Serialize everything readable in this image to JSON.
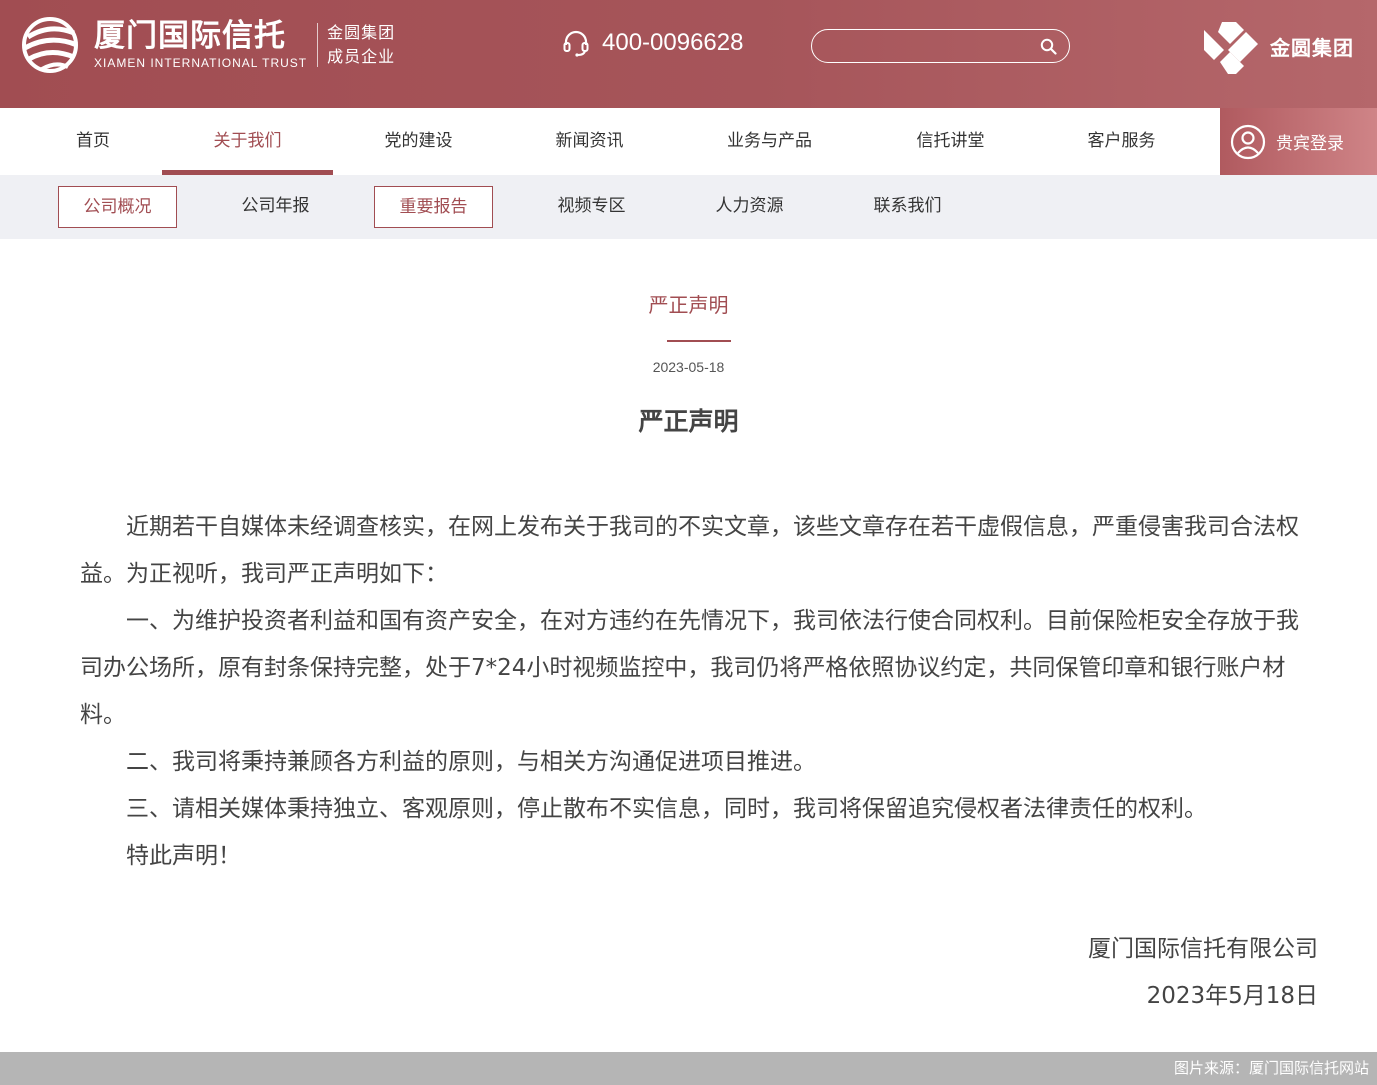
{
  "header": {
    "logo_cn": "厦门国际信托",
    "logo_en": "XIAMEN INTERNATIONAL TRUST",
    "group_line1": "金圆集团",
    "group_line2": "成员企业",
    "hotline": "400-0096628",
    "search_placeholder": "",
    "partner_name": "金圆集团",
    "accent_color": "#a14d52"
  },
  "main_nav": {
    "items": [
      {
        "label": "首页"
      },
      {
        "label": "关于我们",
        "active": true
      },
      {
        "label": "党的建设"
      },
      {
        "label": "新闻资讯"
      },
      {
        "label": "业务与产品"
      },
      {
        "label": "信托讲堂"
      },
      {
        "label": "客户服务"
      }
    ],
    "login_label": "贵宾登录"
  },
  "sub_nav": {
    "items": [
      {
        "label": "公司概况",
        "boxed": true
      },
      {
        "label": "公司年报"
      },
      {
        "label": "重要报告",
        "boxed": true
      },
      {
        "label": "视频专区"
      },
      {
        "label": "人力资源"
      },
      {
        "label": "联系我们"
      }
    ]
  },
  "article": {
    "header_title": "严正声明",
    "date": "2023-05-18",
    "title": "严正声明",
    "paragraphs": [
      "近期若干自媒体未经调查核实，在网上发布关于我司的不实文章，该些文章存在若干虚假信息，严重侵害我司合法权益。为正视听，我司严正声明如下：",
      "一、为维护投资者利益和国有资产安全，在对方违约在先情况下，我司依法行使合同权利。目前保险柜安全存放于我司办公场所，原有封条保持完整，处于7*24小时视频监控中，我司仍将严格依照协议约定，共同保管印章和银行账户材料。",
      "二、我司将秉持兼顾各方利益的原则，与相关方沟通促进项目推进。",
      "三、请相关媒体秉持独立、客观原则，停止散布不实信息，同时，我司将保留追究侵权者法律责任的权利。",
      "特此声明！"
    ],
    "signature_company": "厦门国际信托有限公司",
    "signature_date": "2023年5月18日"
  },
  "footer": {
    "credit": "图片来源：厦门国际信托网站"
  }
}
